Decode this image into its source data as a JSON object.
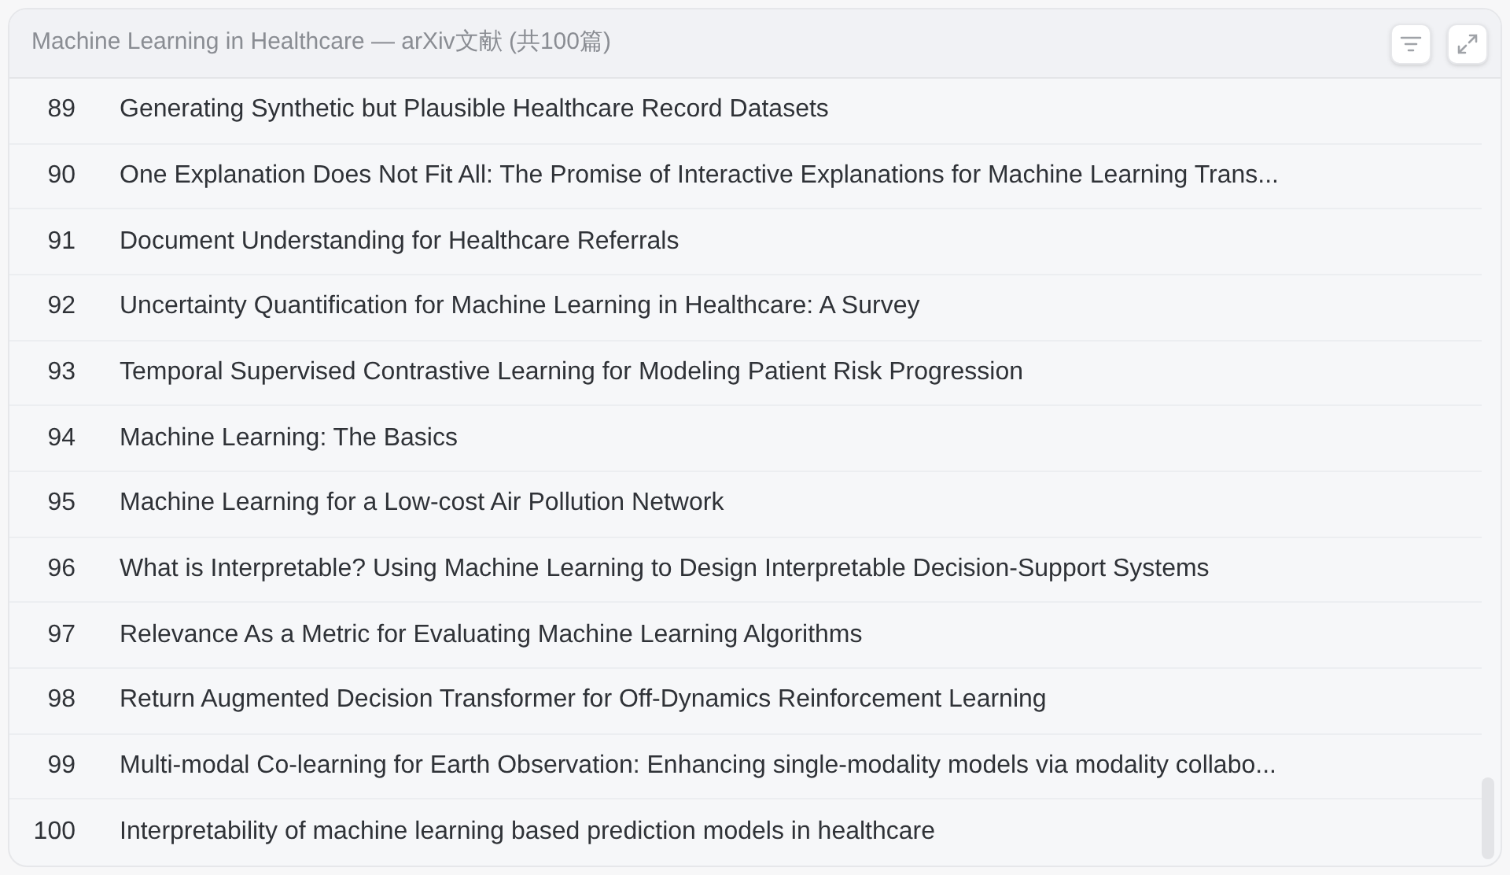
{
  "header": {
    "title": "Machine Learning in Healthcare — arXiv文献 (共100篇)"
  },
  "rows": [
    {
      "index": "89",
      "title": "Generating Synthetic but Plausible Healthcare Record Datasets"
    },
    {
      "index": "90",
      "title": "One Explanation Does Not Fit All: The Promise of Interactive Explanations for Machine Learning Trans..."
    },
    {
      "index": "91",
      "title": "Document Understanding for Healthcare Referrals"
    },
    {
      "index": "92",
      "title": "Uncertainty Quantification for Machine Learning in Healthcare: A Survey"
    },
    {
      "index": "93",
      "title": "Temporal Supervised Contrastive Learning for Modeling Patient Risk Progression"
    },
    {
      "index": "94",
      "title": "Machine Learning: The Basics"
    },
    {
      "index": "95",
      "title": "Machine Learning for a Low-cost Air Pollution Network"
    },
    {
      "index": "96",
      "title": "What is Interpretable? Using Machine Learning to Design Interpretable Decision-Support Systems"
    },
    {
      "index": "97",
      "title": "Relevance As a Metric for Evaluating Machine Learning Algorithms"
    },
    {
      "index": "98",
      "title": "Return Augmented Decision Transformer for Off-Dynamics Reinforcement Learning"
    },
    {
      "index": "99",
      "title": "Multi-modal Co-learning for Earth Observation: Enhancing single-modality models via modality collabo..."
    },
    {
      "index": "100",
      "title": "Interpretability of machine learning based prediction models in healthcare"
    }
  ]
}
